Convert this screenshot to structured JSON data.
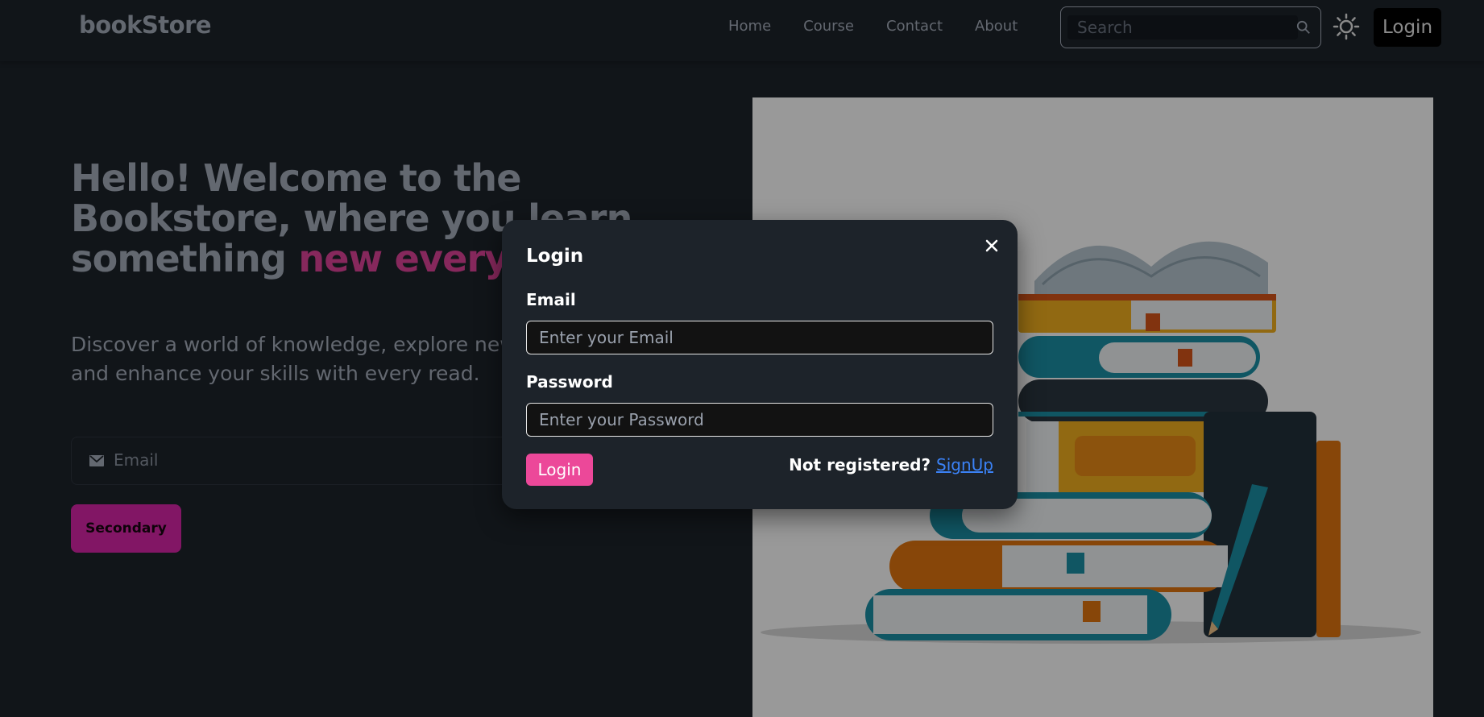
{
  "navbar": {
    "brand": "bookStore",
    "links": [
      "Home",
      "Course",
      "Contact",
      "About"
    ],
    "search_placeholder": "Search",
    "login_label": "Login"
  },
  "hero": {
    "title_main": "Hello! Welcome to the Bookstore, where you learn something ",
    "title_accent": "new everyday !!!",
    "description": "Discover a world of knowledge, explore new horizons, and enhance your skills with every read.",
    "email_placeholder": "Email",
    "secondary_label": "Secondary"
  },
  "modal": {
    "title": "Login",
    "email_label": "Email",
    "email_placeholder": "Enter your Email",
    "password_label": "Password",
    "password_placeholder": "Enter your Password",
    "login_button": "Login",
    "not_registered": "Not registered?",
    "signup_link": "SignUp"
  },
  "colors": {
    "accent": "#ec4899",
    "secondary": "#d926a9",
    "link": "#3b82f6",
    "background": "#1d232a"
  },
  "icons": {
    "search": "search-icon",
    "theme": "sun-icon",
    "mail": "mail-icon",
    "close": "close-icon"
  }
}
